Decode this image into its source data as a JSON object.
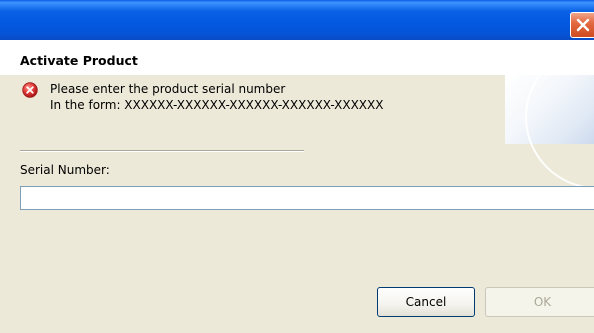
{
  "window": {
    "close_glyph": "✕"
  },
  "header": {
    "title": "Activate Product",
    "message_icon": "error-icon",
    "message_line1": "Please enter the product serial number",
    "message_line2": "In the form: XXXXXX-XXXXXX-XXXXXX-XXXXXX-XXXXXX"
  },
  "form": {
    "serial_label": "Serial Number:",
    "serial_value": "",
    "serial_placeholder": ""
  },
  "buttons": {
    "cancel_label": "Cancel",
    "ok_label": "OK",
    "ok_enabled": false
  },
  "colors": {
    "titlebar": "#0358e0",
    "close_button": "#e46a42",
    "dialog_bg": "#ece9d8",
    "error_red": "#e03a3a"
  }
}
